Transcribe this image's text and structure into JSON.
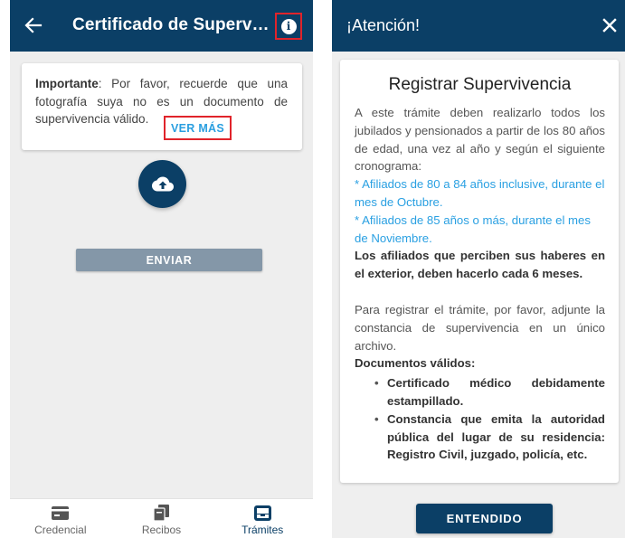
{
  "left_screen": {
    "appbar": {
      "title": "Certificado de Superv…",
      "back_icon": "arrow-left-icon",
      "info_icon": "info-icon"
    },
    "notice": {
      "bold_prefix": "Importante",
      "text": ": Por favor, recuerde que una fotografía suya no es un documento de supervivencia válido.",
      "link_label": "VER MÁS"
    },
    "upload_icon": "cloud-upload-icon",
    "send_label": "ENVIAR",
    "bottom_nav": [
      {
        "label": "Credencial",
        "icon": "credential-card-icon"
      },
      {
        "label": "Recibos",
        "icon": "receipts-icon"
      },
      {
        "label": "Trámites",
        "icon": "inbox-tray-icon"
      }
    ],
    "active_nav": "Trámites"
  },
  "right_screen": {
    "dialog_title": "¡Atención!",
    "close_icon": "close-icon",
    "heading": "Registrar Supervivencia",
    "intro": "A este trámite deben realizarlo todos los jubilados y pensionados a partir de los 80 años de edad, una vez al año y según el siguiente cronograma:",
    "schedule": [
      "* Afiliados de 80 a 84 años inclusive, durante el mes de Octubre.",
      "* Afiliados de 85 años o más, durante el mes de Noviembre."
    ],
    "abroad_note": "Los afiliados que perciben sus haberes en el exterior, deben hacerlo cada 6 meses.",
    "instructions": "Para registrar el trámite, por favor, adjunte la constancia de supervivencia en un único archivo.",
    "documents_heading": "Documentos válidos:",
    "documents": [
      "Certificado médico debidamente estampillado.",
      "Constancia que emita la autoridad pública del lugar de su residencia: Registro Civil, juzgado, policía, etc."
    ],
    "confirm_label": "ENTENDIDO"
  },
  "colors": {
    "primary": "#0b3f66",
    "link": "#2aa0e2",
    "highlight_border": "#e0242b",
    "disabled_button": "#8497a8"
  }
}
